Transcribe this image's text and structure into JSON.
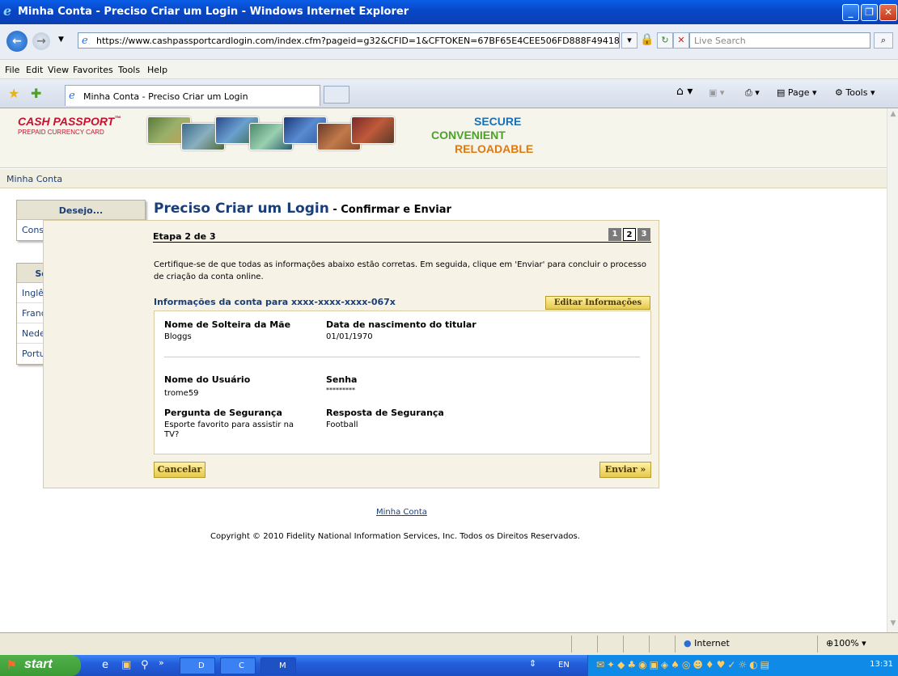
{
  "window": {
    "title": "Minha Conta - Preciso Criar um Login - Windows Internet Explorer",
    "url": "https://www.cashpassportcardlogin.com/index.cfm?pageid=g32&CFID=1&CFTOKEN=67BF65E4CEE506FD888F49418",
    "search_placeholder": "Live Search",
    "menu": [
      "File",
      "Edit",
      "View",
      "Favorites",
      "Tools",
      "Help"
    ],
    "tab_title": "Minha Conta - Preciso Criar um Login",
    "cmd_page": "Page",
    "cmd_tools": "Tools"
  },
  "site": {
    "logo_title": "CASH PASSPORT",
    "logo_tm": "™",
    "logo_sub": "PREPAID CURRENCY CARD",
    "tag_secure": "SECURE",
    "tag_convenient": "CONVENIENT",
    "tag_reloadable": "RELOADABLE",
    "breadcrumb": "Minha Conta"
  },
  "sidebar": {
    "desejo_header": "Desejo...",
    "desejo_items": [
      "Consultar Minha Conta"
    ],
    "lang_header": "Seleção de Idioma",
    "lang_items": [
      "Inglês",
      "Francês",
      "Nederlands",
      "Português"
    ]
  },
  "page": {
    "title": "Preciso Criar um Login",
    "subtitle": " - Confirmar e Enviar",
    "step_text": "Etapa 2 de 3",
    "steps": [
      "1",
      "2",
      "3"
    ],
    "instructions": "Certifique-se de que todas as informações abaixo estão corretas. Em seguida, clique em 'Enviar' para concluir o processo de criação da conta online.",
    "account_header": "Informações da conta para xxxx-xxxx-xxxx-067x",
    "edit_button": "Editar Informações",
    "fields": {
      "mothers_maiden_label": "Nome de Solteira da Mãe",
      "mothers_maiden_value": "Bloggs",
      "dob_label": "Data de nascimento do titular",
      "dob_value": "01/01/1970",
      "username_label": "Nome do Usuário",
      "username_value": "trome59",
      "password_label": "Senha",
      "password_value": "*********",
      "question_label": "Pergunta de Segurança",
      "question_value": "Esporte favorito para assistir na TV?",
      "answer_label": "Resposta de Segurança",
      "answer_value": "Football"
    },
    "cancel_button": "Cancelar",
    "submit_button": "Enviar »"
  },
  "footer": {
    "link": "Minha Conta",
    "copyright": "Copyright © 2010 Fidelity National Information Services, Inc. Todos os Direitos Reservados."
  },
  "status": {
    "zone": "Internet",
    "zoom": "100%"
  },
  "taskbar": {
    "start": "start",
    "buttons": [
      "D",
      "C",
      "M"
    ],
    "lang": "EN",
    "time": "13:31"
  }
}
